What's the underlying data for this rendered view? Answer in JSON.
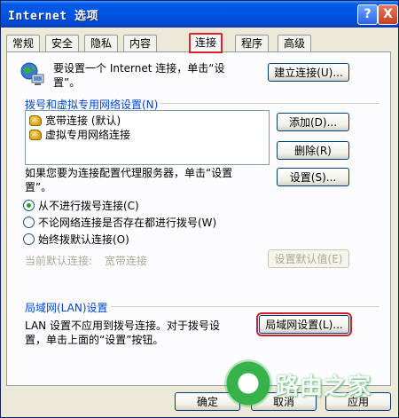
{
  "window": {
    "title": "Internet 选项",
    "help_label": "?",
    "close_label": "X"
  },
  "tabs": [
    {
      "label": "常规"
    },
    {
      "label": "安全"
    },
    {
      "label": "隐私"
    },
    {
      "label": "内容"
    },
    {
      "label": "连接",
      "active": true
    },
    {
      "label": "程序"
    },
    {
      "label": "高级"
    }
  ],
  "setup": {
    "description": "要设置一个 Internet 连接，单击“设置”。",
    "description_line1": "要设置一个 Internet 连接，单击“设",
    "description_line2": "置”。",
    "button": "建立连接(U)..."
  },
  "dialup": {
    "group_label": "拨号和虚拟专用网络设置(N)",
    "items": [
      {
        "label": "宽带连接 (默认)"
      },
      {
        "label": "虚拟专用网络连接"
      }
    ],
    "add_button": "添加(D)...",
    "remove_button": "删除(R)",
    "settings_button": "设置(S)...",
    "proxy_text_line1": "如果您要为连接配置代理服务器，单击“设置",
    "proxy_text_line2": "置”。",
    "options": [
      {
        "label": "从不进行拨号连接(C)",
        "selected": true
      },
      {
        "label": "不论网络连接是否存在都进行拨号(W)",
        "selected": false
      },
      {
        "label": "始终拨默认连接(O)",
        "selected": false
      }
    ],
    "current_default_label": "当前默认连接:",
    "current_default_value": "宽带连接",
    "set_default_button": "设置默认值(E)"
  },
  "lan": {
    "group_label": "局域网(LAN)设置",
    "text_line1": "LAN 设置不应用到拨号连接。对于拨号设",
    "text_line2": "置，单击上面的“设置”按钮。",
    "button": "局域网设置(L)..."
  },
  "footer": {
    "ok_button": "确定",
    "cancel_button": "取消",
    "apply_button": "应用"
  },
  "watermark": {
    "text": "路由之家"
  },
  "colors": {
    "title_bar": "#0055e5",
    "group_label": "#0046d5",
    "highlight": "#d0202a",
    "watermark_green": "#37b24a"
  }
}
